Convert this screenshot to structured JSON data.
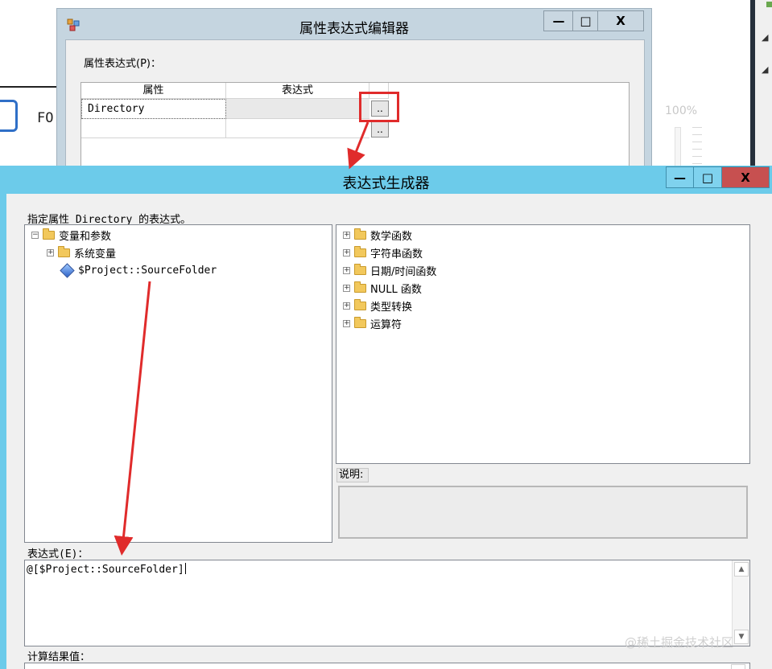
{
  "background": {
    "partial_text": "FO",
    "zoom_label": "100%"
  },
  "property_editor": {
    "title": "属性表达式编辑器",
    "min_glyph": "—",
    "max_glyph": "□",
    "close_glyph": "X",
    "label": "属性表达式(P)：",
    "columns": [
      "属性",
      "表达式"
    ],
    "rows": [
      {
        "property": "Directory",
        "expression": ""
      }
    ],
    "ellipsis": ".."
  },
  "expression_builder": {
    "title": "表达式生成器",
    "min_glyph": "—",
    "max_glyph": "□",
    "close_glyph": "X",
    "hint": "指定属性 Directory 的表达式。",
    "variables_tree": {
      "root": "变量和参数",
      "root_toggle": "−",
      "children": [
        {
          "label": "系统变量",
          "toggle": "+"
        },
        {
          "label": "$Project::SourceFolder"
        }
      ]
    },
    "functions_tree": [
      {
        "label": "数学函数",
        "toggle": "+"
      },
      {
        "label": "字符串函数",
        "toggle": "+"
      },
      {
        "label": "日期/时间函数",
        "toggle": "+"
      },
      {
        "label": "NULL 函数",
        "toggle": "+"
      },
      {
        "label": "类型转换",
        "toggle": "+"
      },
      {
        "label": "运算符",
        "toggle": "+"
      }
    ],
    "description_label": "说明:",
    "expression_label": "表达式(E)：",
    "expression_value": "@[$Project::SourceFolder]",
    "result_label": "计算结果值：",
    "scroll_up": "▲",
    "scroll_down": "▼"
  },
  "watermark": "@稀土掘金技术社区",
  "colors": {
    "builder_title_bar": "#6ccbea",
    "close_button": "#c75050",
    "annotation": "#e02b2b",
    "folder": "#f2c85c"
  }
}
